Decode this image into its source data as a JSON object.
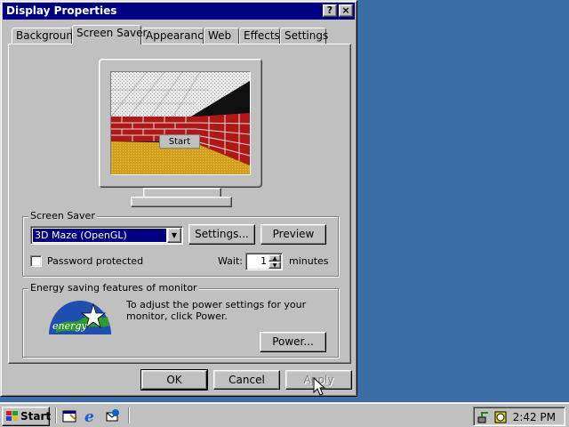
{
  "window": {
    "title": "Display Properties",
    "help_button": "?",
    "close_button": "×"
  },
  "tabs": [
    {
      "label": "Background",
      "active": false
    },
    {
      "label": "Screen Saver",
      "active": true
    },
    {
      "label": "Appearance",
      "active": false
    },
    {
      "label": "Web",
      "active": false
    },
    {
      "label": "Effects",
      "active": false
    },
    {
      "label": "Settings",
      "active": false
    }
  ],
  "preview": {
    "start_label": "Start"
  },
  "screen_saver": {
    "group_title": "Screen Saver",
    "selected": "3D Maze (OpenGL)",
    "settings_button": "Settings...",
    "preview_button": "Preview",
    "password_label": "Password protected",
    "password_checked": false,
    "wait_label": "Wait:",
    "wait_value": "1",
    "wait_unit": "minutes"
  },
  "energy": {
    "group_title": "Energy saving features of monitor",
    "description": "To adjust the power settings for your monitor, click Power.",
    "power_button": "Power...",
    "logo_text": "energy"
  },
  "footer": {
    "ok": "OK",
    "cancel": "Cancel",
    "apply": "Apply"
  },
  "taskbar": {
    "start": "Start",
    "clock": "2:42 PM"
  },
  "colors": {
    "desktop": "#3a6ea5",
    "titlebar": "#000080",
    "face": "#c0c0c0"
  }
}
